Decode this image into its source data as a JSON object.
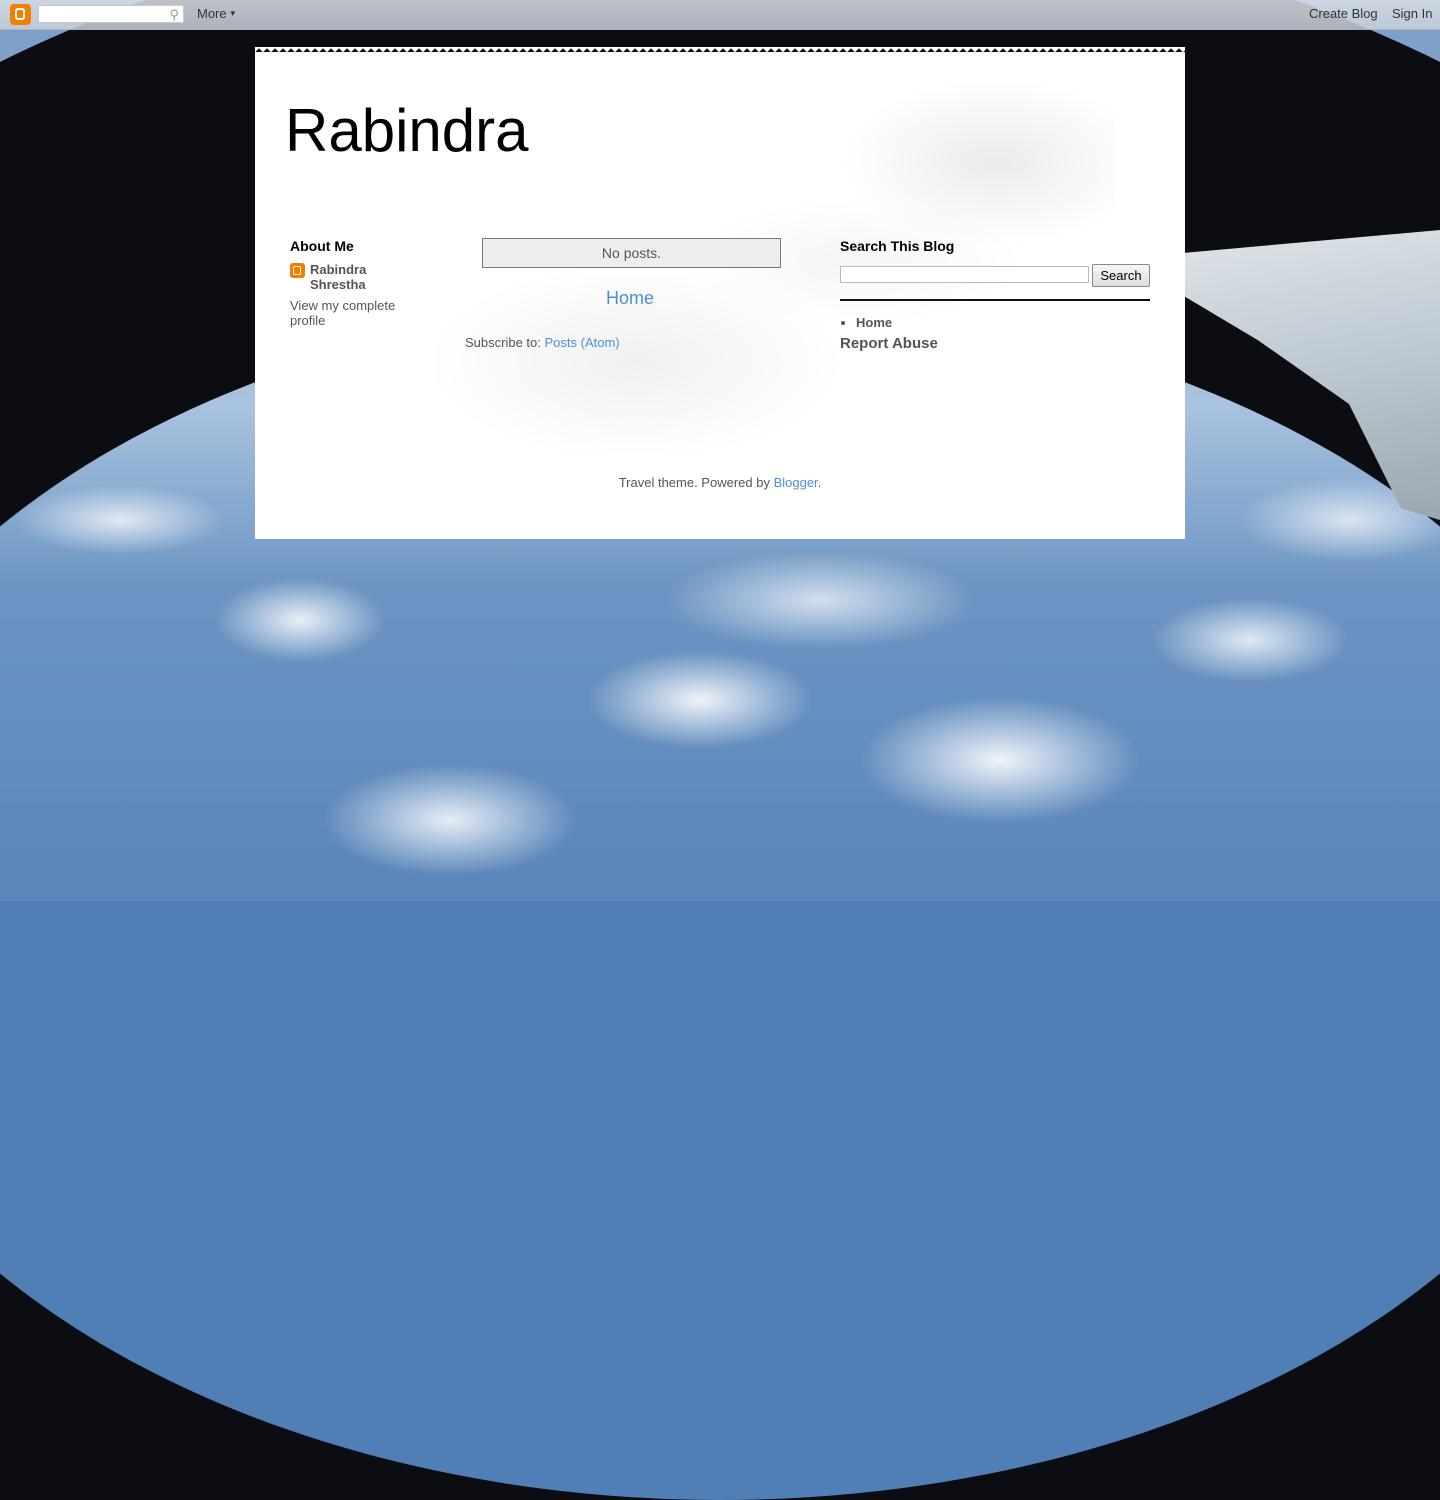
{
  "navbar": {
    "logo_icon": "blogger-logo-icon",
    "search_placeholder": "",
    "search_icon": "magnifier-icon",
    "more_label": "More",
    "create_blog_label": "Create Blog",
    "sign_in_label": "Sign In"
  },
  "blog": {
    "title": "Rabindra"
  },
  "about_me": {
    "heading": "About Me",
    "name": "Rabindra Shrestha",
    "profile_link": "View my complete profile"
  },
  "main": {
    "no_posts": "No posts.",
    "home_link": "Home",
    "subscribe_prefix": "Subscribe to:",
    "subscribe_link": "Posts (Atom)"
  },
  "search_widget": {
    "heading": "Search This Blog",
    "input_value": "",
    "button_label": "Search"
  },
  "pages": {
    "items": [
      "Home"
    ]
  },
  "report_abuse": "Report Abuse",
  "footer": {
    "text": "Travel theme. Powered by ",
    "link": "Blogger",
    "suffix": "."
  },
  "colors": {
    "accent_link": "#4d8fd6",
    "blogger_orange": "#f57d00"
  }
}
